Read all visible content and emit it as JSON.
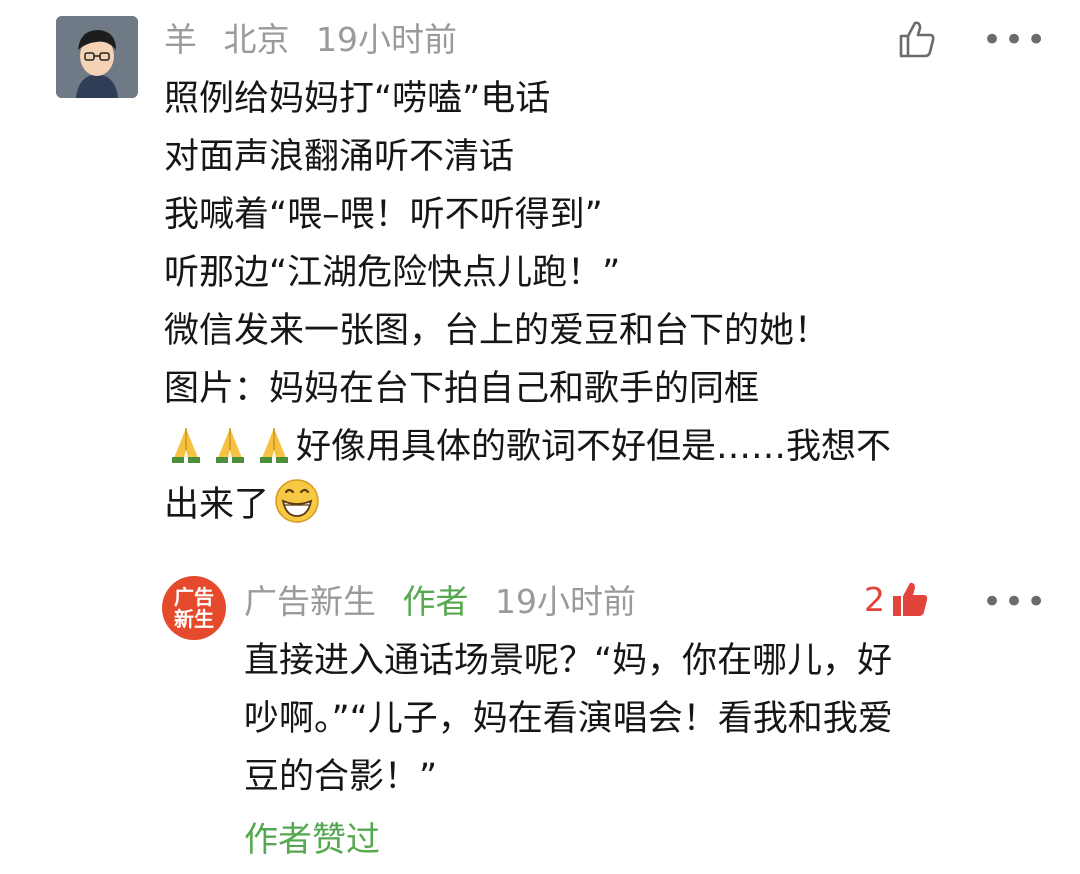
{
  "comment": {
    "username": "羊",
    "location": "北京",
    "time": "19小时前",
    "lines": [
      "照例给妈妈打“唠嗑”电话",
      "对面声浪翻涌听不清话",
      "我喊着“喂–喂！听不听得到”",
      "听那边“江湖危险快点儿跑！”",
      "微信发来一张图，台上的爱豆和台下的她！",
      "图片：妈妈在台下拍自己和歌手的同框"
    ],
    "line7_text": "好像用具体的歌词不好但是……我想不",
    "line8_text": "出来了",
    "emoji_prayer": "folded-hands-icon",
    "emoji_grin": "grinning-face-icon"
  },
  "reply": {
    "avatar_text": "广告\n新生",
    "username": "广告新生",
    "author_tag": "作者",
    "time": "19小时前",
    "like_count": "2",
    "lines": [
      "直接进入通话场景呢？“妈，你在哪儿，好",
      "吵啊。”“儿子，妈在看演唱会！看我和我爱",
      "豆的合影！”"
    ],
    "liked_by_author": "作者赞过"
  },
  "icons": {
    "like": "thumbs-up-outline-icon",
    "like_filled": "thumbs-up-filled-icon",
    "more": "more-dots-icon"
  },
  "colors": {
    "meta_gray": "#9a9a9a",
    "author_green": "#55a84f",
    "like_red": "#e0443a",
    "reply_avatar_bg": "#e54a2c"
  }
}
